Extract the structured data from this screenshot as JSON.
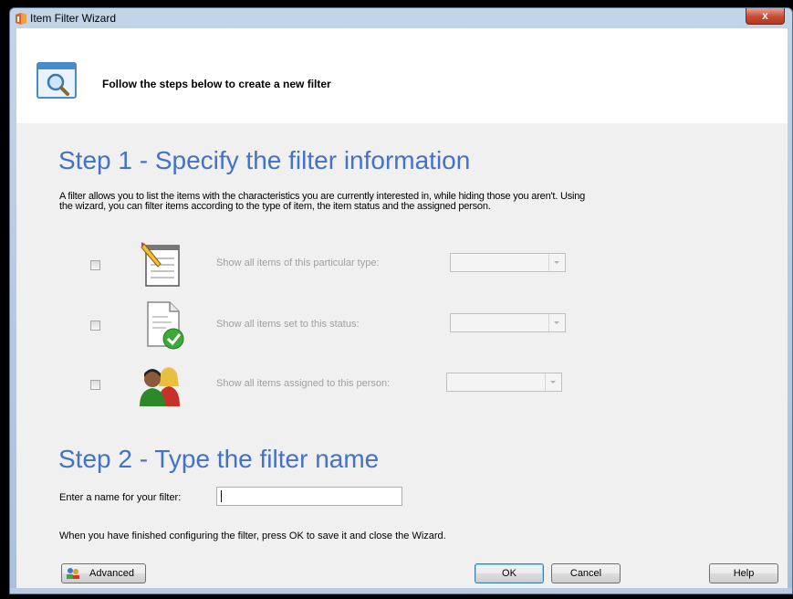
{
  "window": {
    "title": "Item Filter Wizard",
    "close_label": "x"
  },
  "header": {
    "text": "Follow the steps below to create a new filter"
  },
  "step1": {
    "title": "Step 1 - Specify the filter information",
    "description": "A filter allows you to list the items with the characteristics you are currently interested in, while hiding those you aren't.  Using the wizard, you can filter items according to the type of item, the item status and the assigned person.",
    "rows": [
      {
        "label": "Show all items of this particular type:",
        "icon": "notepad-pencil-icon",
        "checked": false,
        "value": ""
      },
      {
        "label": "Show all items set to this status:",
        "icon": "document-check-icon",
        "checked": false,
        "value": ""
      },
      {
        "label": "Show all items assigned to this person:",
        "icon": "people-icon",
        "checked": false,
        "value": ""
      }
    ]
  },
  "step2": {
    "title": "Step 2 - Type the filter name",
    "name_label": "Enter a name for your filter:",
    "name_value": "",
    "finish_text": "When you have finished configuring the filter, press OK to save it and close the Wizard."
  },
  "buttons": {
    "advanced": "Advanced",
    "ok": "OK",
    "cancel": "Cancel",
    "help": "Help"
  },
  "colors": {
    "step_title": "#4472c4",
    "close_button": "#c74a33"
  }
}
